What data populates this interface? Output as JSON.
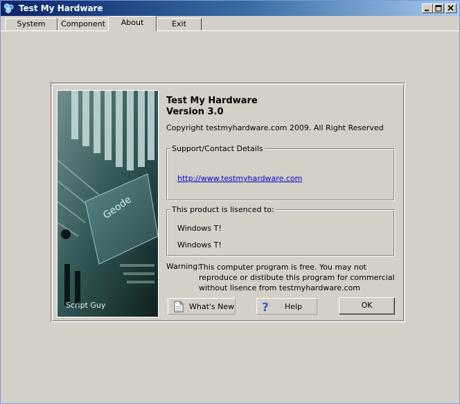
{
  "window": {
    "title": "Test My  Hardware",
    "icon": "app-icon"
  },
  "tabs": [
    {
      "label": "System"
    },
    {
      "label": "Component"
    },
    {
      "label": "About",
      "active": true
    },
    {
      "label": "Exit"
    }
  ],
  "about": {
    "image_caption": "Script Guy",
    "product_name": "Test My Hardware",
    "version": "Version 3.0",
    "copyright": "Copyright testmyhardware.com 2009. All Right Reserved",
    "support": {
      "legend": "Support/Contact Details",
      "url": "http://www.testmyhardware.com"
    },
    "license": {
      "legend": "This product is  lisenced to:",
      "lines": [
        "Windows T!",
        "Windows T!"
      ]
    },
    "warning_label": "Warning:",
    "warning_text": "This computer program is free. You may not reproduce or distibute this program for commercial without lisence from testmyhardware.com",
    "buttons": {
      "whats_new": "What's New",
      "help": "Help",
      "ok": "OK"
    }
  }
}
